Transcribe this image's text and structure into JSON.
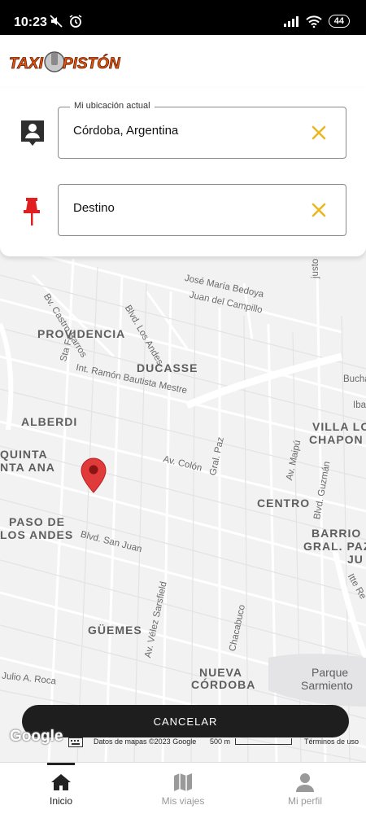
{
  "status_bar": {
    "time": "10:23",
    "battery": "44",
    "icons": [
      "mute-icon",
      "alarm-icon",
      "signal-icon",
      "wifi-icon",
      "battery-icon"
    ]
  },
  "header": {
    "logo_text": "TAXI PISTÓN"
  },
  "search": {
    "origin": {
      "label": "Mi ubicación actual",
      "value": "Córdoba, Argentina",
      "icon": "person-location-icon"
    },
    "destination": {
      "placeholder": "Destino",
      "icon": "pushpin-icon"
    },
    "clear_icon": "close-icon",
    "accent_color": "#e8b923",
    "pin_color": "#e02020"
  },
  "map": {
    "areas": [
      "PROVIDENCIA",
      "DUCASSE",
      "ALBERDI",
      "QUINTA",
      "NTA ANA",
      "PASO DE",
      "LOS ANDES",
      "CENTRO",
      "VILLA LO",
      "CHAPON",
      "BARRIO",
      "GRAL. PAZ",
      "JU",
      "GÜEMES",
      "NUEVA",
      "CÓRDOBA"
    ],
    "streets": [
      "Bv. Castro Barros",
      "José María Bedoya",
      "Juan del Campillo",
      "Blvd. Los Andes",
      "Sta Fe",
      "Int. Ramón Bautista Mestre",
      "Av. Colón",
      "Gral. Paz",
      "Av. Maipú",
      "Blvd. Guzmán",
      "Blvd. San Juan",
      "Av. Vélez Sarsfield",
      "Chacabuco",
      "Julio A. Roca",
      "Parque",
      "Sarmiento",
      "Bucha",
      "Iba",
      "Itte Re",
      "justo"
    ],
    "attribution": "Datos de mapas ©2023 Google",
    "scale": "500 m",
    "terms": "Términos de uso",
    "google": "Google"
  },
  "actions": {
    "cancel": "CANCELAR"
  },
  "nav": {
    "items": [
      {
        "label": "Inicio",
        "icon": "home-icon",
        "active": true
      },
      {
        "label": "Mis viajes",
        "icon": "map-icon",
        "active": false
      },
      {
        "label": "Mi perfil",
        "icon": "person-icon",
        "active": false
      }
    ]
  }
}
